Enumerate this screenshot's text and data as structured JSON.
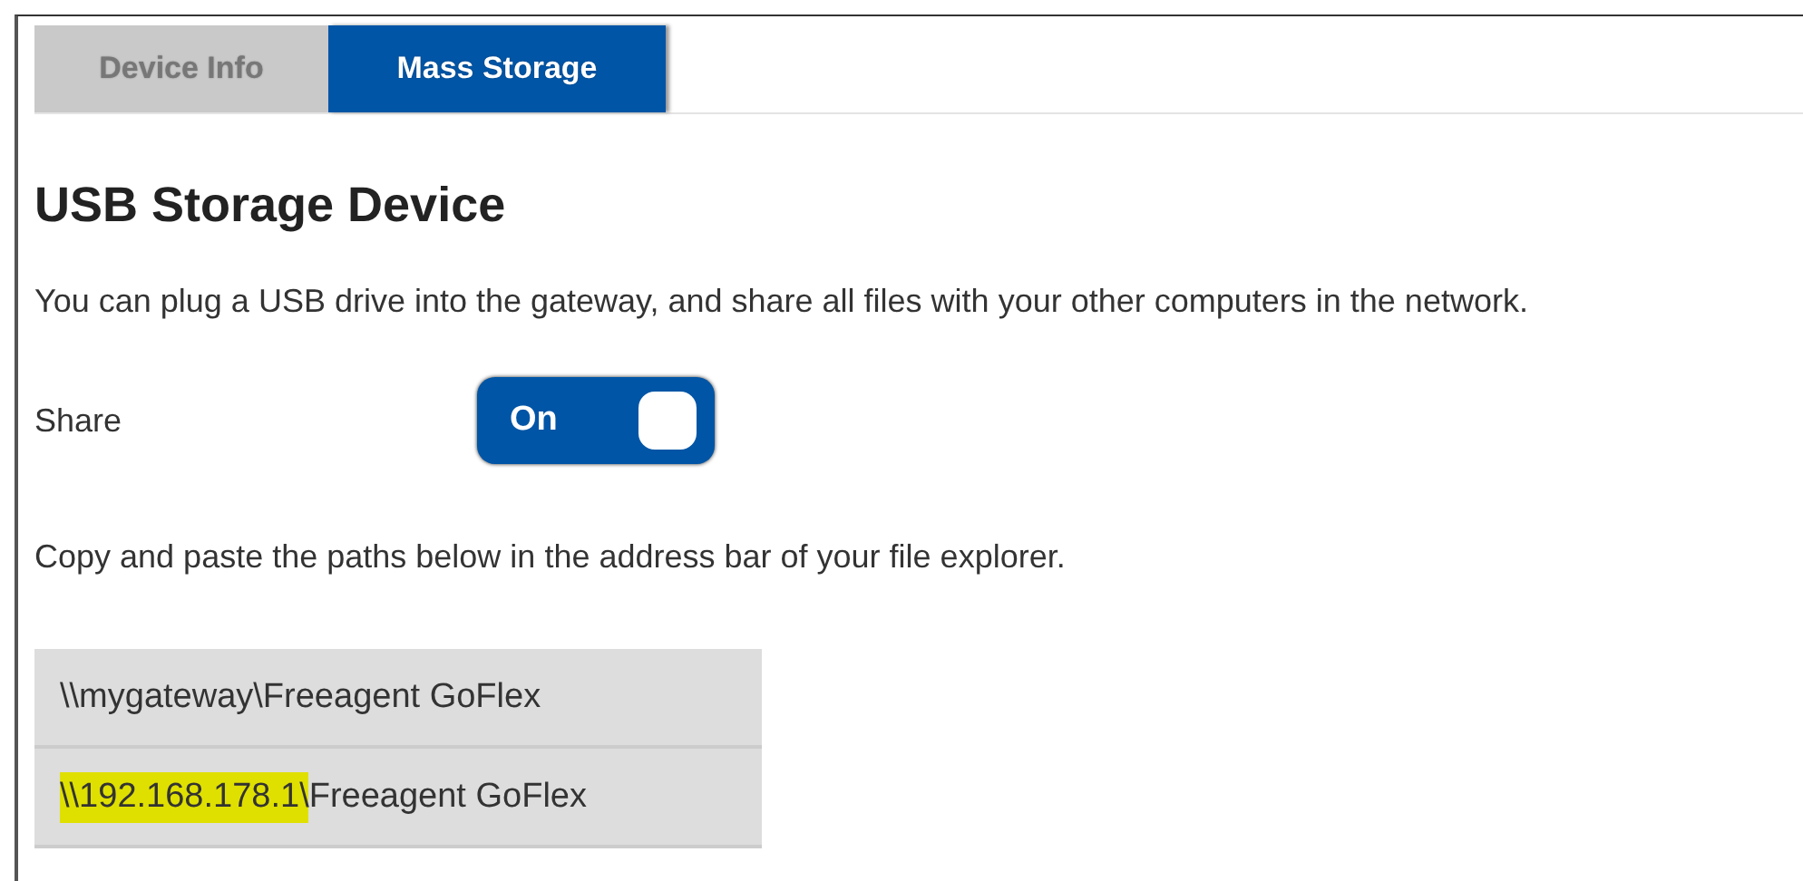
{
  "tabs": [
    {
      "label": "Device Info",
      "selected": false
    },
    {
      "label": "Mass Storage",
      "selected": true
    }
  ],
  "heading": "USB Storage Device",
  "description": "You can plug a USB drive into the gateway, and share all files with your other computers in the network.",
  "share": {
    "label": "Share",
    "on": true,
    "state_label": "On"
  },
  "instructions": "Copy and paste the paths below in the address bar of your file explorer.",
  "paths": [
    {
      "parts": [
        {
          "text": "\\\\mygateway\\Freeagent GoFlex",
          "highlighted": false
        }
      ]
    },
    {
      "parts": [
        {
          "text": "\\\\192.168.178.1\\",
          "highlighted": true
        },
        {
          "text": "Freeagent GoFlex",
          "highlighted": false
        }
      ]
    }
  ]
}
